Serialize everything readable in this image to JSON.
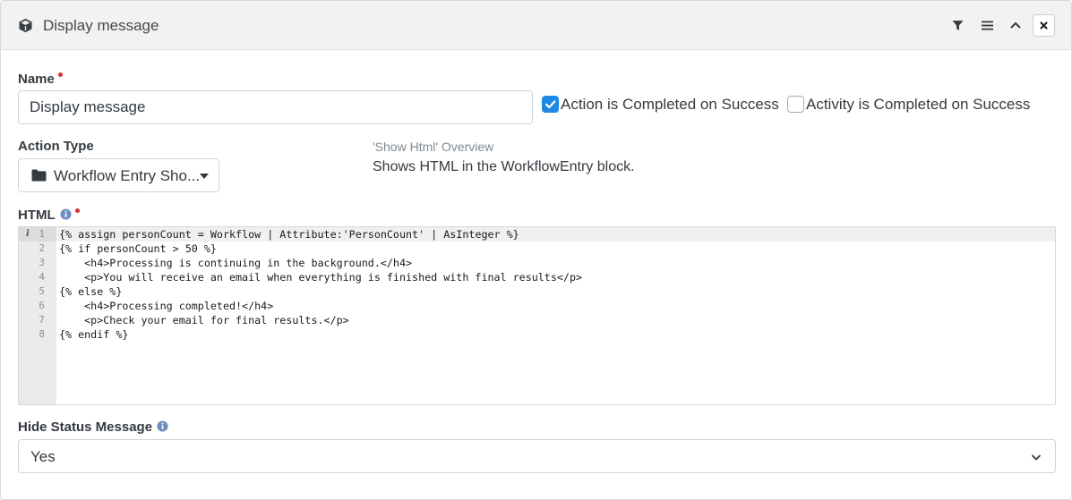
{
  "header": {
    "title": "Display message",
    "icons": {
      "action": "cube-icon",
      "filter": "filter-icon",
      "menu": "bars-icon",
      "collapse": "chevron-up-icon",
      "close": "close-icon"
    }
  },
  "name_field": {
    "label": "Name",
    "value": "Display message",
    "required": true
  },
  "checkboxes": [
    {
      "label": "Action is Completed on Success",
      "checked": true
    },
    {
      "label": "Activity is Completed on Success",
      "checked": false
    }
  ],
  "action_type": {
    "label": "Action Type",
    "selected": "Workflow Entry Sho...",
    "icon": "folder-icon"
  },
  "overview": {
    "title": "'Show Html' Overview",
    "description": "Shows HTML in the WorkflowEntry block."
  },
  "html_field": {
    "label": "HTML",
    "required": true,
    "line_numbers": [
      "1",
      "2",
      "3",
      "4",
      "5",
      "6",
      "7",
      "8"
    ],
    "gutter_marker": "i",
    "code_lines": [
      "{% assign personCount = Workflow | Attribute:'PersonCount' | AsInteger %}",
      "{% if personCount > 50 %}",
      "    <h4>Processing is continuing in the background.</h4>",
      "    <p>You will receive an email when everything is finished with final results</p>",
      "{% else %}",
      "    <h4>Processing completed!</h4>",
      "    <p>Check your email for final results.</p>",
      "{% endif %}"
    ]
  },
  "hide_status": {
    "label": "Hide Status Message",
    "selected": "Yes"
  },
  "colors": {
    "accent": "#1e88e5",
    "required": "#d9302f",
    "info": "#6c8ebf"
  }
}
